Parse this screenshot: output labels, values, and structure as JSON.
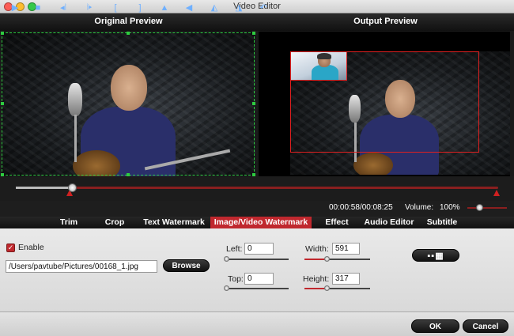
{
  "window": {
    "title": "Video Editor"
  },
  "preview": {
    "original_label": "Original Preview",
    "output_label": "Output Preview"
  },
  "playback": {
    "time": "00:00:58/00:08:25",
    "volume_label": "Volume:",
    "volume_value": "100%",
    "position_fraction": 0.115
  },
  "tabs": [
    {
      "label": "Trim"
    },
    {
      "label": "Crop"
    },
    {
      "label": "Text Watermark"
    },
    {
      "label": "Image/Video Watermark",
      "active": true
    },
    {
      "label": "Effect"
    },
    {
      "label": "Audio Editor"
    },
    {
      "label": "Subtitle"
    }
  ],
  "watermark": {
    "enable_label": "Enable",
    "enabled": true,
    "path": "/Users/pavtube/Pictures/00168_1.jpg",
    "browse_label": "Browse",
    "left_label": "Left:",
    "left_value": "0",
    "top_label": "Top:",
    "top_value": "0",
    "width_label": "Width:",
    "width_value": "591",
    "height_label": "Height:",
    "height_value": "317"
  },
  "footer": {
    "ok_label": "OK",
    "cancel_label": "Cancel"
  },
  "colors": {
    "accent": "#c0282e",
    "crop_frame": "#2ecc40",
    "control_icon": "#6fb0ff"
  }
}
